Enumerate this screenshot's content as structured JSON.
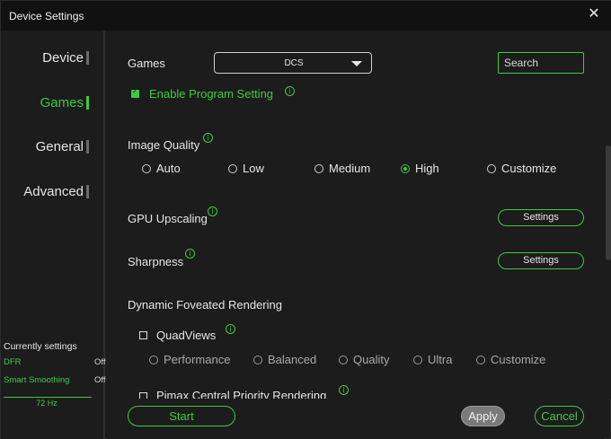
{
  "window": {
    "title": "Device Settings",
    "close_icon": "✕"
  },
  "sidebar": {
    "items": [
      {
        "label": "Device",
        "active": false
      },
      {
        "label": "Games",
        "active": true
      },
      {
        "label": "General",
        "active": false
      },
      {
        "label": "Advanced",
        "active": false
      }
    ],
    "current": {
      "heading": "Currently settings",
      "rows": [
        {
          "key": "DFR",
          "value": "Off"
        },
        {
          "key": "Smart Smoothing",
          "value": "Off"
        }
      ],
      "refresh": "72 Hz"
    }
  },
  "games": {
    "label": "Games",
    "selected": "DCS",
    "search_placeholder": "Search",
    "enable_program_setting": "Enable Program Setting"
  },
  "image_quality": {
    "label": "Image Quality",
    "options": [
      "Auto",
      "Low",
      "Medium",
      "High",
      "Customize"
    ],
    "selected": "High"
  },
  "gpu_upscaling": {
    "label": "GPU Upscaling",
    "button": "Settings"
  },
  "sharpness": {
    "label": "Sharpness",
    "button": "Settings"
  },
  "dfr": {
    "label": "Dynamic Foveated Rendering",
    "quadviews": "QuadViews",
    "options": [
      "Performance",
      "Balanced",
      "Quality",
      "Ultra",
      "Customize"
    ],
    "pimax_cpr": "Pimax Central Priority Rendering"
  },
  "footer": {
    "start": "Start",
    "apply": "Apply",
    "cancel": "Cancel"
  },
  "colors": {
    "accent": "#3fcb3f",
    "background": "#1c1c1c",
    "titlebar": "#111111"
  }
}
